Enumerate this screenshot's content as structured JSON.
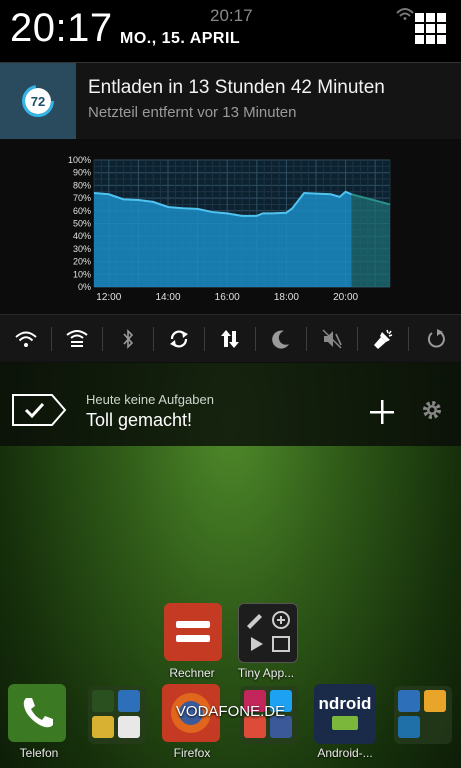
{
  "status_bar": {
    "clock_large": "20:17",
    "clock_small": "20:17",
    "date": "MO., 15. APRIL"
  },
  "notification": {
    "battery_level": "72",
    "title": "Entladen in 13 Stunden 42 Minuten",
    "subtitle": "Netzteil entfernt vor 13 Minuten"
  },
  "chart_data": {
    "type": "area",
    "x_tick_labels": [
      "12:00",
      "14:00",
      "16:00",
      "18:00",
      "20:00"
    ],
    "y_tick_labels": [
      "100%",
      "90%",
      "80%",
      "70%",
      "60%",
      "50%",
      "40%",
      "30%",
      "20%",
      "10%",
      "0%"
    ],
    "xlim_hours": [
      11.5,
      21.5
    ],
    "ylim": [
      0,
      100
    ],
    "grid": true,
    "series": [
      {
        "style": "measured",
        "color": "#1b8bc4",
        "x": [
          11.5,
          12.0,
          12.5,
          13.0,
          13.5,
          14.0,
          14.5,
          15.0,
          15.5,
          16.0,
          16.5,
          17.0,
          17.2,
          17.5,
          18.0,
          18.2,
          18.4,
          18.6,
          19.0,
          19.5,
          19.8,
          19.9,
          20.0,
          20.2
        ],
        "y": [
          74,
          73,
          69,
          68.5,
          67,
          63,
          62,
          61.5,
          59,
          58,
          56,
          56,
          58,
          58,
          58.5,
          62,
          68,
          74,
          73.5,
          73,
          71,
          73,
          75,
          73
        ]
      },
      {
        "style": "projected",
        "color": "#1d6e73",
        "x": [
          20.2,
          21.5
        ],
        "y": [
          73,
          65
        ]
      }
    ]
  },
  "quick_settings": [
    {
      "name": "wifi-toggle",
      "icon": "wifi-icon"
    },
    {
      "name": "hotspot-toggle",
      "icon": "hotspot-icon"
    },
    {
      "name": "bluetooth-toggle",
      "icon": "bluetooth-icon"
    },
    {
      "name": "sync-toggle",
      "icon": "sync-icon"
    },
    {
      "name": "mobile-data-toggle",
      "icon": "data-arrows-icon"
    },
    {
      "name": "night-mode-toggle",
      "icon": "moon-icon"
    },
    {
      "name": "sound-toggle",
      "icon": "muted-speaker-icon"
    },
    {
      "name": "flashlight-toggle",
      "icon": "flashlight-icon"
    },
    {
      "name": "auto-rotate-toggle",
      "icon": "rotate-icon"
    }
  ],
  "widget": {
    "label": "Heute keine Aufgaben",
    "message": "Toll gemacht!"
  },
  "home": {
    "apps": [
      {
        "label": "Rechner"
      },
      {
        "label": "Tiny App..."
      },
      {
        "label": "Telefon"
      },
      {
        "label": "Firefox"
      },
      {
        "label": "Android-..."
      }
    ],
    "carrier": "VODAFONE.DE",
    "android_logo_text": "ndroid"
  },
  "colors": {
    "accent": "#33b5e5",
    "chart_fill": "#1b8bc4",
    "projection_fill": "#1d6e73"
  }
}
